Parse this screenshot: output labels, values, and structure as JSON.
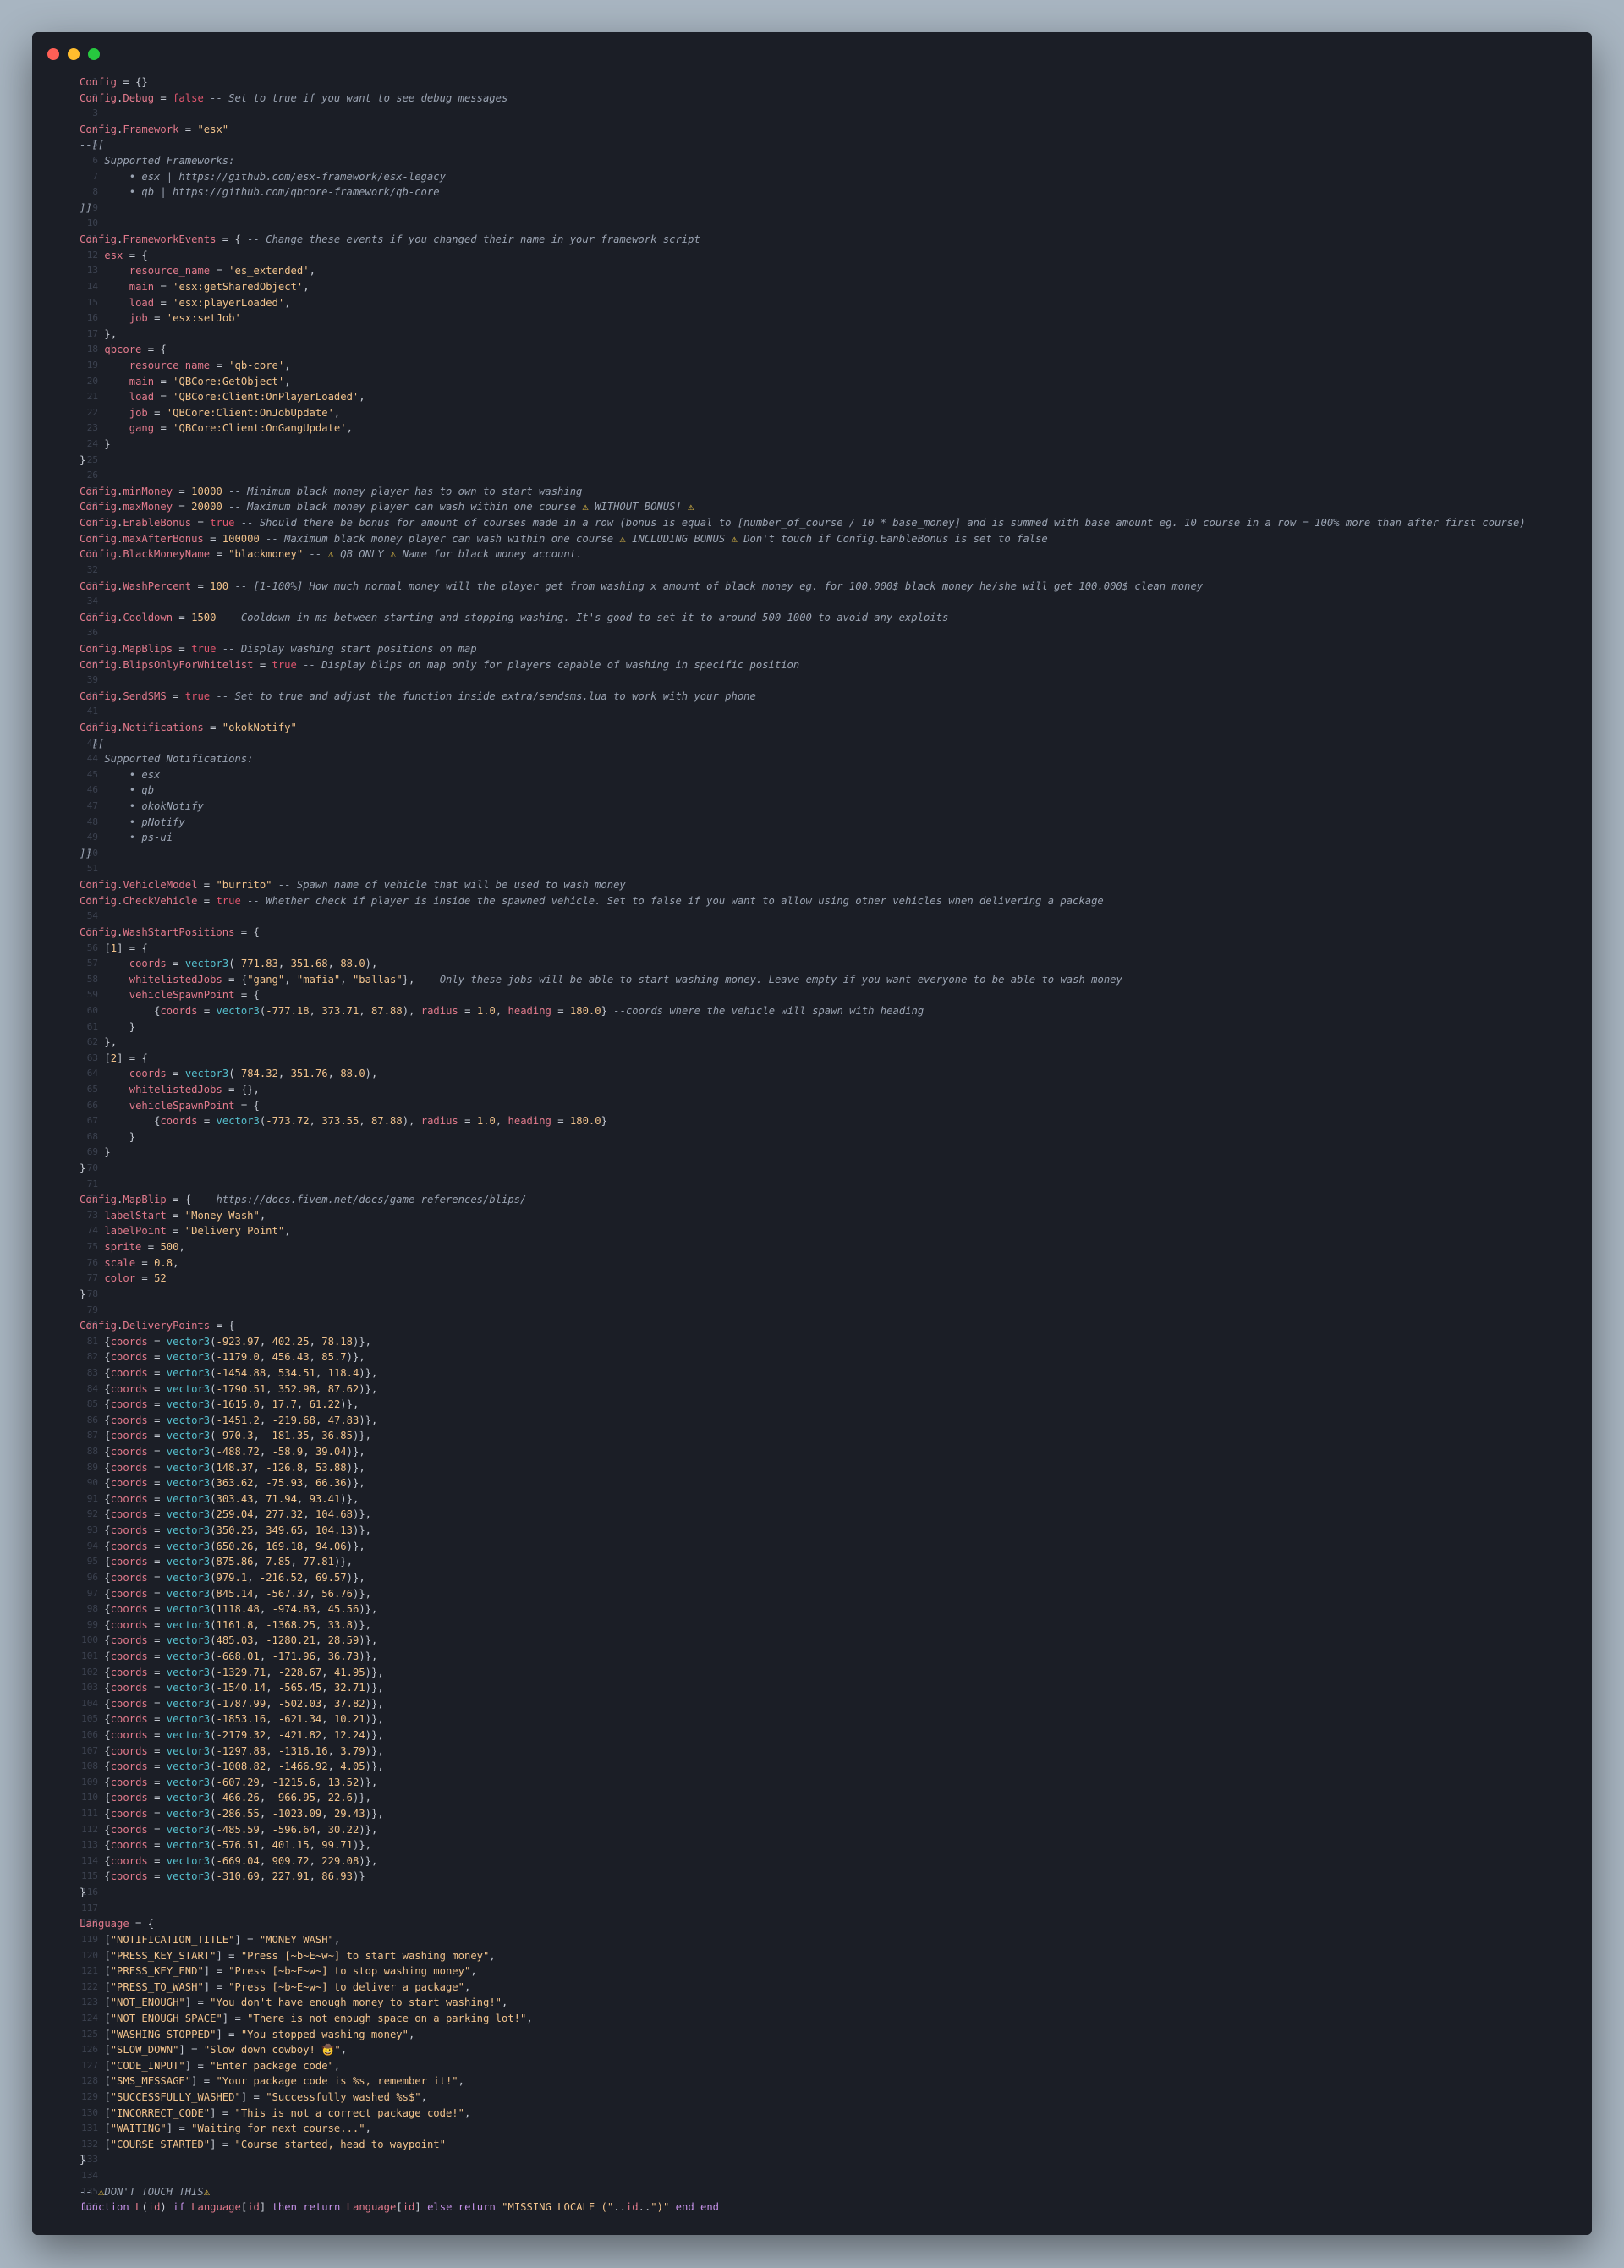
{
  "window": {
    "controls": [
      "close",
      "minimize",
      "maximize"
    ],
    "colors": {
      "close": "#ff5f56",
      "minimize": "#ffbd2e",
      "maximize": "#27c93f",
      "background": "#1b1e26"
    }
  },
  "editor": {
    "language": "lua",
    "line_count": 136,
    "lines": [
      "Config = {}",
      "Config.Debug = false -- Set to true if you want to see debug messages",
      "",
      "Config.Framework = \"esx\"",
      "--[[",
      "    Supported Frameworks:",
      "        • esx | https://github.com/esx-framework/esx-legacy",
      "        • qb | https://github.com/qbcore-framework/qb-core",
      "]]",
      "",
      "Config.FrameworkEvents = { -- Change these events if you changed their name in your framework script",
      "    esx = {",
      "        resource_name = 'es_extended',",
      "        main = 'esx:getSharedObject',",
      "        load = 'esx:playerLoaded',",
      "        job = 'esx:setJob'",
      "    },",
      "    qbcore = {",
      "        resource_name = 'qb-core',",
      "        main = 'QBCore:GetObject',",
      "        load = 'QBCore:Client:OnPlayerLoaded',",
      "        job = 'QBCore:Client:OnJobUpdate',",
      "        gang = 'QBCore:Client:OnGangUpdate',",
      "    }",
      "}",
      "",
      "Config.minMoney = 10000 -- Minimum black money player has to own to start washing",
      "Config.maxMoney = 20000 -- Maximum black money player can wash within one course ⚠️ WITHOUT BONUS! ⚠️",
      "Config.EnableBonus = true -- Should there be bonus for amount of courses made in a row (bonus is equal to [number_of_course / 10 * base_money] and is summed with base amount eg. 10 course in a row = 100% more than after first course)",
      "Config.maxAfterBonus = 100000 -- Maximum black money player can wash within one course ⚠️ INCLUDING BONUS ⚠️ Don't touch if Config.EanbleBonus is set to false",
      "Config.BlackMoneyName = \"blackmoney\" -- ⚠️ QB ONLY ⚠️ Name for black money account.",
      "",
      "Config.WashPercent = 100 -- [1-100%] How much normal money will the player get from washing x amount of black money eg. for 100.000$ black money he/she will get 100.000$ clean money",
      "",
      "Config.Cooldown = 1500 -- Cooldown in ms between starting and stopping washing. It's good to set it to around 500-1000 to avoid any exploits",
      "",
      "Config.MapBlips = true -- Display washing start positions on map",
      "Config.BlipsOnlyForWhitelist = true -- Display blips on map only for players capable of washing in specific position",
      "",
      "Config.SendSMS = true -- Set to true and adjust the function inside extra/sendsms.lua to work with your phone",
      "",
      "Config.Notifications = \"okokNotify\"",
      "--[[",
      "    Supported Notifications:",
      "        • esx",
      "        • qb",
      "        • okokNotify",
      "        • pNotify",
      "        • ps-ui",
      "]]",
      "",
      "Config.VehicleModel = \"burrito\" -- Spawn name of vehicle that will be used to wash money",
      "Config.CheckVehicle = true -- Whether check if player is inside the spawned vehicle. Set to false if you want to allow using other vehicles when delivering a package",
      "",
      "Config.WashStartPositions = {",
      "    [1] = {",
      "        coords = vector3(-771.83, 351.68, 88.0),",
      "        whitelistedJobs = {\"gang\", \"mafia\", \"ballas\"}, -- Only these jobs will be able to start washing money. Leave empty if you want everyone to be able to wash money",
      "        vehicleSpawnPoint = {",
      "            {coords = vector3(-777.18, 373.71, 87.88), radius = 1.0, heading = 180.0} --coords where the vehicle will spawn with heading",
      "        }",
      "    },",
      "    [2] = {",
      "        coords = vector3(-784.32, 351.76, 88.0),",
      "        whitelistedJobs = {},",
      "        vehicleSpawnPoint = {",
      "            {coords = vector3(-773.72, 373.55, 87.88), radius = 1.0, heading = 180.0}",
      "        }",
      "    }",
      "}",
      "",
      "Config.MapBlip = { -- https://docs.fivem.net/docs/game-references/blips/",
      "    labelStart = \"Money Wash\",",
      "    labelPoint = \"Delivery Point\",",
      "    sprite = 500,",
      "    scale = 0.8,",
      "    color = 52",
      "}",
      "",
      "Config.DeliveryPoints = {",
      "    {coords = vector3(-923.97, 402.25, 78.18)},",
      "    {coords = vector3(-1179.0, 456.43, 85.7)},",
      "    {coords = vector3(-1454.88, 534.51, 118.4)},",
      "    {coords = vector3(-1790.51, 352.98, 87.62)},",
      "    {coords = vector3(-1615.0, 17.7, 61.22)},",
      "    {coords = vector3(-1451.2, -219.68, 47.83)},",
      "    {coords = vector3(-970.3, -181.35, 36.85)},",
      "    {coords = vector3(-488.72, -58.9, 39.04)},",
      "    {coords = vector3(148.37, -126.8, 53.88)},",
      "    {coords = vector3(363.62, -75.93, 66.36)},",
      "    {coords = vector3(303.43, 71.94, 93.41)},",
      "    {coords = vector3(259.04, 277.32, 104.68)},",
      "    {coords = vector3(350.25, 349.65, 104.13)},",
      "    {coords = vector3(650.26, 169.18, 94.06)},",
      "    {coords = vector3(875.86, 7.85, 77.81)},",
      "    {coords = vector3(979.1, -216.52, 69.57)},",
      "    {coords = vector3(845.14, -567.37, 56.76)},",
      "    {coords = vector3(1118.48, -974.83, 45.56)},",
      "    {coords = vector3(1161.8, -1368.25, 33.8)},",
      "    {coords = vector3(485.03, -1280.21, 28.59)},",
      "    {coords = vector3(-668.01, -171.96, 36.73)},",
      "    {coords = vector3(-1329.71, -228.67, 41.95)},",
      "    {coords = vector3(-1540.14, -565.45, 32.71)},",
      "    {coords = vector3(-1787.99, -502.03, 37.82)},",
      "    {coords = vector3(-1853.16, -621.34, 10.21)},",
      "    {coords = vector3(-2179.32, -421.82, 12.24)},",
      "    {coords = vector3(-1297.88, -1316.16, 3.79)},",
      "    {coords = vector3(-1008.82, -1466.92, 4.05)},",
      "    {coords = vector3(-607.29, -1215.6, 13.52)},",
      "    {coords = vector3(-466.26, -966.95, 22.6)},",
      "    {coords = vector3(-286.55, -1023.09, 29.43)},",
      "    {coords = vector3(-485.59, -596.64, 30.22)},",
      "    {coords = vector3(-576.51, 401.15, 99.71)},",
      "    {coords = vector3(-669.04, 909.72, 229.08)},",
      "    {coords = vector3(-310.69, 227.91, 86.93)}",
      "}",
      "",
      "Language = {",
      "    [\"NOTIFICATION_TITLE\"] = \"MONEY WASH\",",
      "    [\"PRESS_KEY_START\"] = \"Press [~b~E~w~] to start washing money\",",
      "    [\"PRESS_KEY_END\"] = \"Press [~b~E~w~] to stop washing money\",",
      "    [\"PRESS_TO_WASH\"] = \"Press [~b~E~w~] to deliver a package\",",
      "    [\"NOT_ENOUGH\"] = \"You don't have enough money to start washing!\",",
      "    [\"NOT_ENOUGH_SPACE\"] = \"There is not enough space on a parking lot!\",",
      "    [\"WASHING_STOPPED\"] = \"You stopped washing money\",",
      "    [\"SLOW_DOWN\"] = \"Slow down cowboy! 🤠\",",
      "    [\"CODE_INPUT\"] = \"Enter package code\",",
      "    [\"SMS_MESSAGE\"] = \"Your package code is %s, remember it!\",",
      "    [\"SUCCESSFULLY_WASHED\"] = \"Successfully washed %s$\",",
      "    [\"INCORRECT_CODE\"] = \"This is not a correct package code!\",",
      "    [\"WAITING\"] = \"Waiting for next course...\",",
      "    [\"COURSE_STARTED\"] = \"Course started, head to waypoint\"",
      "}",
      "",
      "-- ⚠️DON'T TOUCH THIS⚠️",
      "function L(id) if Language[id] then return Language[id] else return \"MISSING LOCALE (\"..id..\")\" end end"
    ]
  }
}
